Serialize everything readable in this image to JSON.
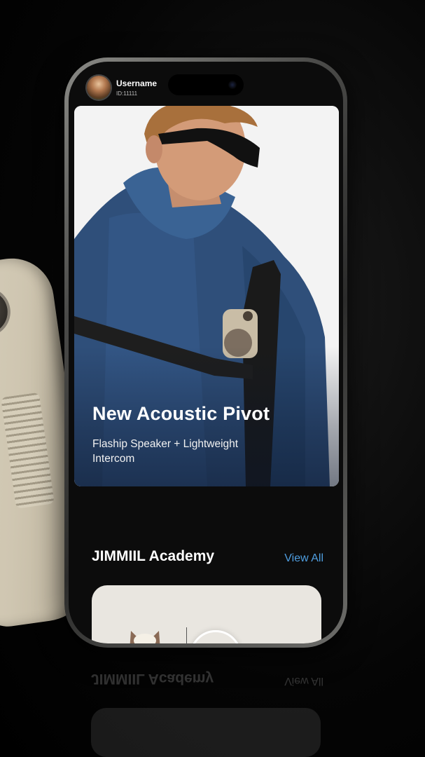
{
  "user": {
    "name": "Username",
    "id": "ID:11111"
  },
  "hero": {
    "title": "New Acoustic Pivot",
    "subtitle": "Flaship Speaker + Lightweight Intercom"
  },
  "academy": {
    "title": "JIMMIIL Academy",
    "view_all": "View All"
  },
  "colors": {
    "accent": "#4f9ee0",
    "jacket": "#2f4f7a",
    "background": "#000000"
  }
}
